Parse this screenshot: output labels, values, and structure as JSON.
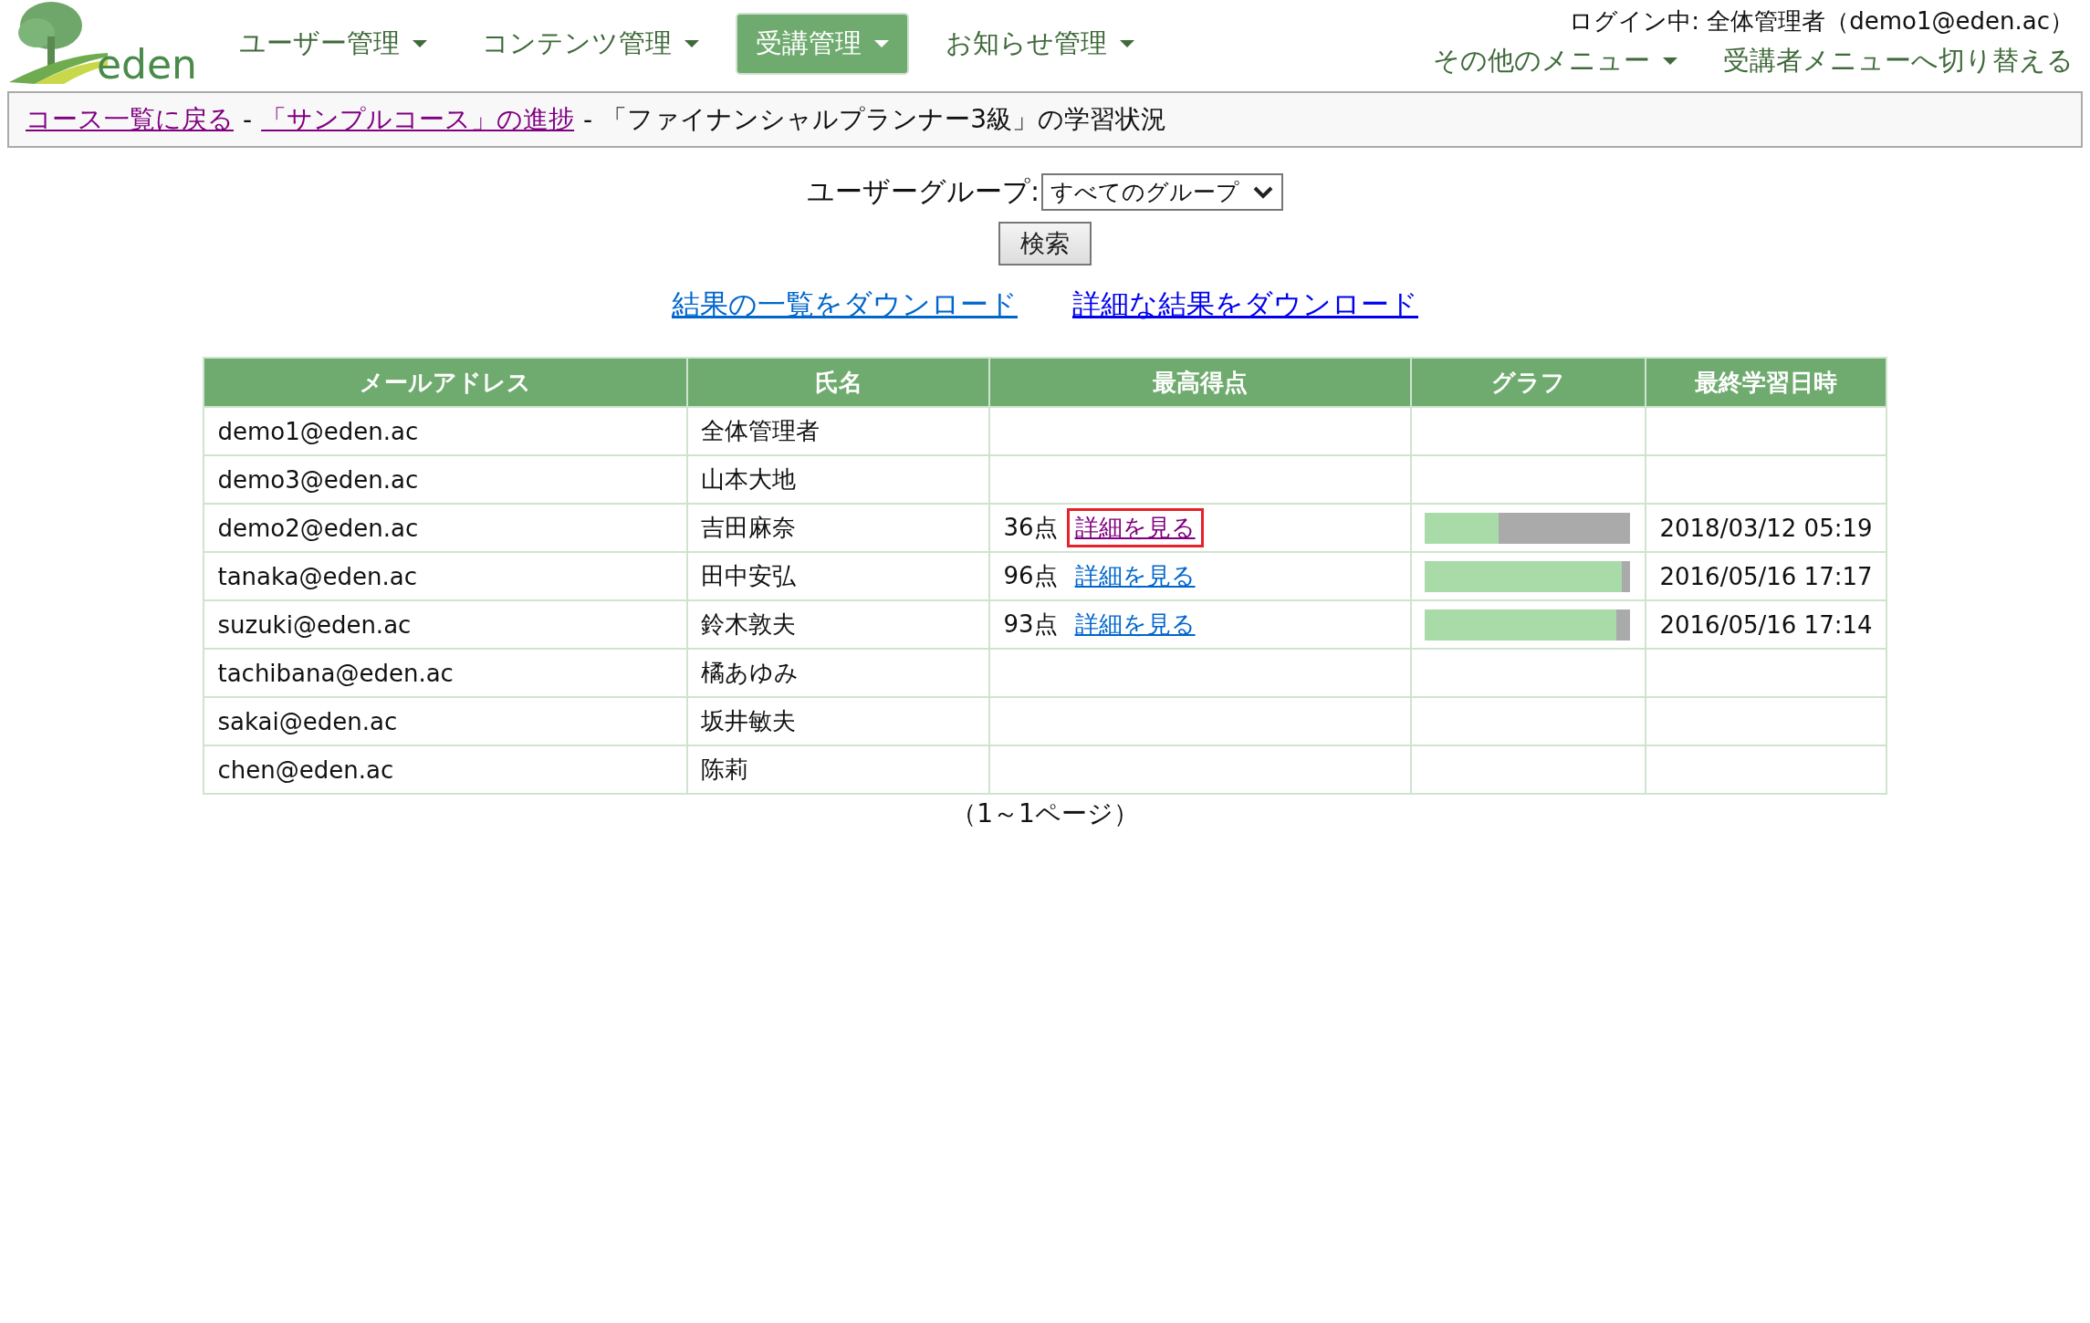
{
  "logo_text": "eden",
  "nav": {
    "items": [
      {
        "label": "ユーザー管理",
        "selected": false
      },
      {
        "label": "コンテンツ管理",
        "selected": false
      },
      {
        "label": "受講管理",
        "selected": true
      },
      {
        "label": "お知らせ管理",
        "selected": false
      }
    ],
    "login": "ログイン中: 全体管理者（demo1@eden.ac）",
    "other_menu": "その他のメニュー",
    "switch_link": "受講者メニューへ切り替える"
  },
  "breadcrumb": [
    {
      "text": "コース一覧に戻る",
      "kind": "link"
    },
    {
      "text": "-",
      "kind": "sep"
    },
    {
      "text": "「サンプルコース」の進捗",
      "kind": "link"
    },
    {
      "text": "-",
      "kind": "sep"
    },
    {
      "text": "「ファイナンシャルプランナー3級」の学習状況",
      "kind": "text"
    }
  ],
  "filter": {
    "label": "ユーザーグループ:",
    "value": "すべてのグループ",
    "button": "検索"
  },
  "downloads": [
    {
      "text": "結果の一覧をダウンロード"
    },
    {
      "text": "詳細な結果をダウンロード"
    }
  ],
  "table": {
    "columns": [
      "メールアドレス",
      "氏名",
      "最高得点",
      "グラフ",
      "最終学習日時"
    ],
    "rows": [
      {
        "email": "demo1@eden.ac",
        "name": "全体管理者"
      },
      {
        "email": "demo3@eden.ac",
        "name": "山本大地"
      },
      {
        "email": "demo2@eden.ac",
        "name": "吉田麻奈",
        "score": "36点",
        "detail": {
          "text": "詳細を見る",
          "visited": true,
          "highlighted": true
        },
        "level": 0.36,
        "date": "2018/03/12 05:19"
      },
      {
        "email": "tanaka@eden.ac",
        "name": "田中安弘",
        "score": "96点",
        "detail": {
          "text": "詳細を見る",
          "visited": false,
          "highlighted": false
        },
        "level": 0.96,
        "date": "2016/05/16 17:17"
      },
      {
        "email": "suzuki@eden.ac",
        "name": "鈴木敦夫",
        "score": "93点",
        "detail": {
          "text": "詳細を見る",
          "visited": false,
          "highlighted": false
        },
        "level": 0.93,
        "date": "2016/05/16 17:14"
      },
      {
        "email": "tachibana@eden.ac",
        "name": "橘あゆみ"
      },
      {
        "email": "sakai@eden.ac",
        "name": "坂井敏夫"
      },
      {
        "email": "chen@eden.ac",
        "name": "陈莉"
      }
    ]
  },
  "pagination": "（1～1ページ）"
}
